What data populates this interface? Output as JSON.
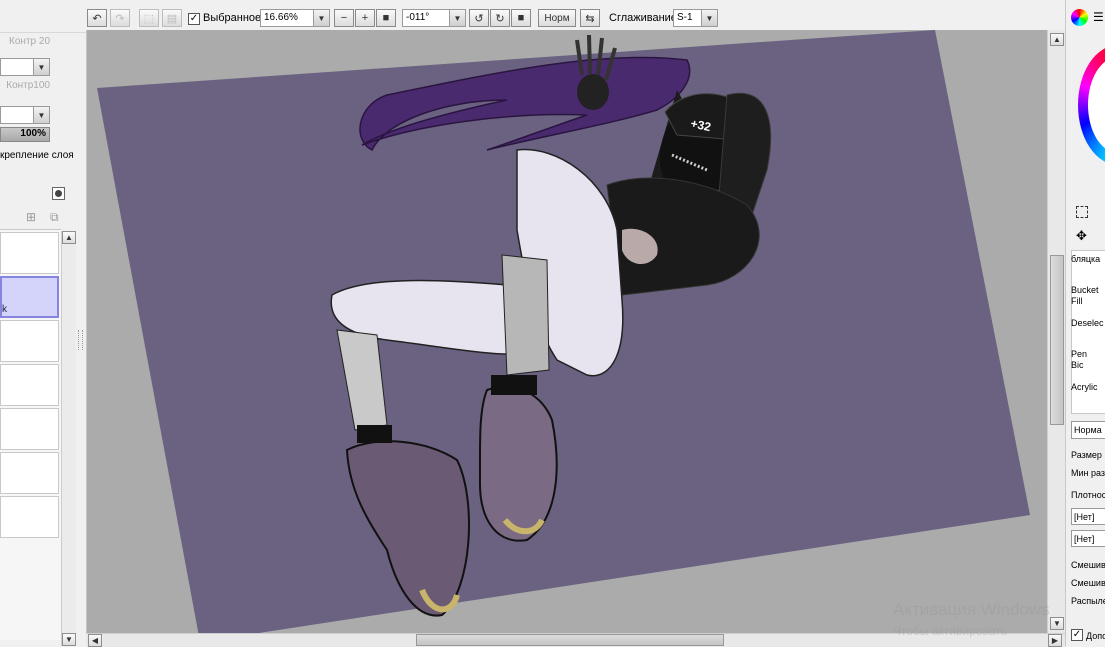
{
  "toolbar": {
    "selected_label": "Выбранное",
    "selected_checked": true,
    "zoom": "16.66%",
    "rotation": "-011°",
    "norm_button": "Норм",
    "smoothing_label": "Сглаживание",
    "smoothing_value": "S-1"
  },
  "left_panel": {
    "contrast_1": "Контр 20",
    "contrast_2": "Контр100",
    "opacity": "100%",
    "layer_pin_label": "крепление слоя",
    "active_layer_suffix": "k"
  },
  "right_panel": {
    "tools": [
      {
        "label": "бляцка"
      },
      {
        "label": "Bucket Fill"
      },
      {
        "label": "Deselec"
      },
      {
        "label": "Pen Bic"
      },
      {
        "label": "Acrylic"
      }
    ],
    "blend_mode": "Норма",
    "size_label": "Размер",
    "min_size_label": "Мин раз",
    "density_label": "Плотнос",
    "texture_none_1": "[Нет]",
    "texture_none_2": "[Нет]",
    "mix_label_1": "Смешива",
    "mix_label_2": "Смешива",
    "spray_label": "Распыле",
    "extra_label": "Допо"
  },
  "watermark": {
    "line1": "Активация Windows",
    "line2": "Чтобы активировать"
  },
  "canvas": {
    "cap_text": "+32",
    "paper_color": "#6a6280",
    "background_color": "#ababab"
  }
}
